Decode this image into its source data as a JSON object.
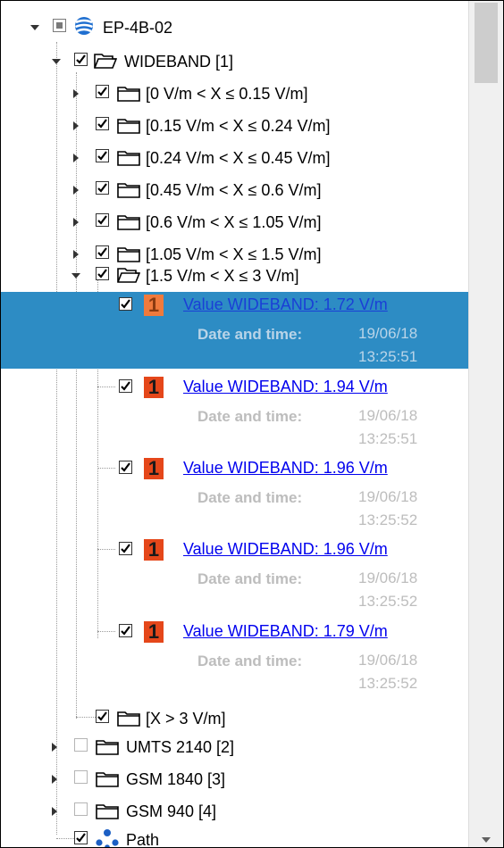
{
  "root": {
    "label": "EP-4B-02"
  },
  "wideband": {
    "label": "WIDEBAND [1]"
  },
  "ranges": [
    "[0 V/m < X ≤ 0.15 V/m]",
    "[0.15 V/m < X ≤ 0.24 V/m]",
    "[0.24 V/m < X ≤ 0.45 V/m]",
    "[0.45 V/m < X ≤ 0.6 V/m]",
    "[0.6 V/m < X ≤ 1.05 V/m]",
    "[1.05 V/m < X ≤ 1.5 V/m]",
    "[1.5 V/m < X ≤ 3 V/m]"
  ],
  "measurements": [
    {
      "badge": "1",
      "value": "Value WIDEBAND: 1.72 V/m",
      "date_label": "Date and time:",
      "date": "19/06/18",
      "time": "13:25:51"
    },
    {
      "badge": "1",
      "value": "Value WIDEBAND: 1.94 V/m",
      "date_label": "Date and time:",
      "date": "19/06/18",
      "time": "13:25:51"
    },
    {
      "badge": "1",
      "value": "Value WIDEBAND: 1.96 V/m",
      "date_label": "Date and time:",
      "date": "19/06/18",
      "time": "13:25:52"
    },
    {
      "badge": "1",
      "value": "Value WIDEBAND: 1.96 V/m",
      "date_label": "Date and time:",
      "date": "19/06/18",
      "time": "13:25:52"
    },
    {
      "badge": "1",
      "value": "Value WIDEBAND: 1.79 V/m",
      "date_label": "Date and time:",
      "date": "19/06/18",
      "time": "13:25:52"
    }
  ],
  "over_range": {
    "label": "[X > 3 V/m]"
  },
  "bands": [
    {
      "label": "UMTS 2140 [2]"
    },
    {
      "label": "GSM 1840 [3]"
    },
    {
      "label": "GSM 940 [4]"
    }
  ],
  "path": {
    "label": "Path"
  },
  "colors": {
    "selection": "#2d8cc4",
    "badge": "#e5471a",
    "link": "#0000ee"
  },
  "icons": {
    "root": "globe-icon",
    "folder": "folder-icon",
    "open_folder": "folder-open-icon",
    "path": "path-nodes-icon",
    "scroll_down": "arrow-down-icon"
  }
}
